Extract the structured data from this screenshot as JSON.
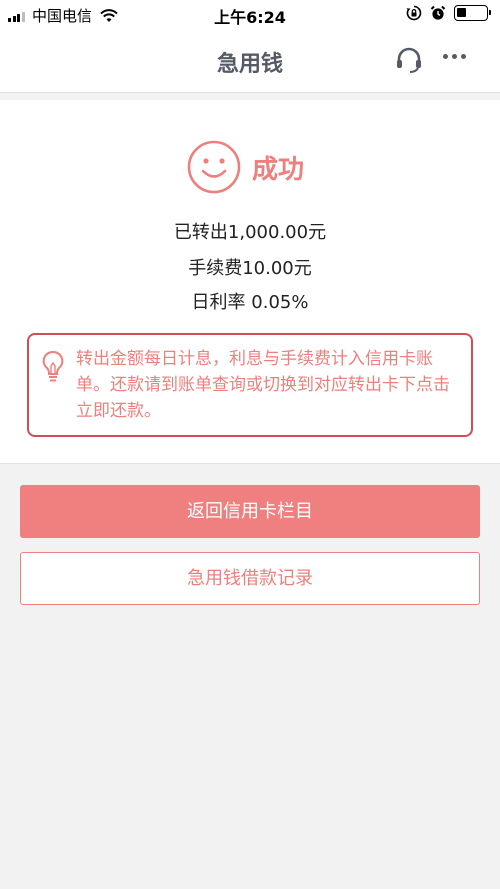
{
  "status_bar": {
    "carrier": "中国电信",
    "time": "上午6:24",
    "icons": [
      "signal-icon",
      "wifi-icon",
      "orientation-lock-icon",
      "alarm-icon",
      "battery-icon"
    ]
  },
  "nav": {
    "title": "急用钱",
    "icons": [
      "headset-icon",
      "more-icon"
    ]
  },
  "result": {
    "status": "成功",
    "status_icon": "smile-icon",
    "transferred": "已转出1,000.00元",
    "fee": "手续费10.00元",
    "daily_rate": "日利率 0.05%"
  },
  "notice": {
    "icon": "lightbulb-icon",
    "text": "转出金额每日计息，利息与手续费计入信用卡账单。还款请到账单查询或切换到对应转出卡下点击立即还款。"
  },
  "buttons": {
    "primary": "返回信用卡栏目",
    "secondary": "急用钱借款记录"
  },
  "colors": {
    "accent": "#f0807f",
    "accent_text": "#ef7f7c",
    "notice_border": "#d34d57",
    "nav_text": "#555a66",
    "background": "#f2f2f2"
  }
}
